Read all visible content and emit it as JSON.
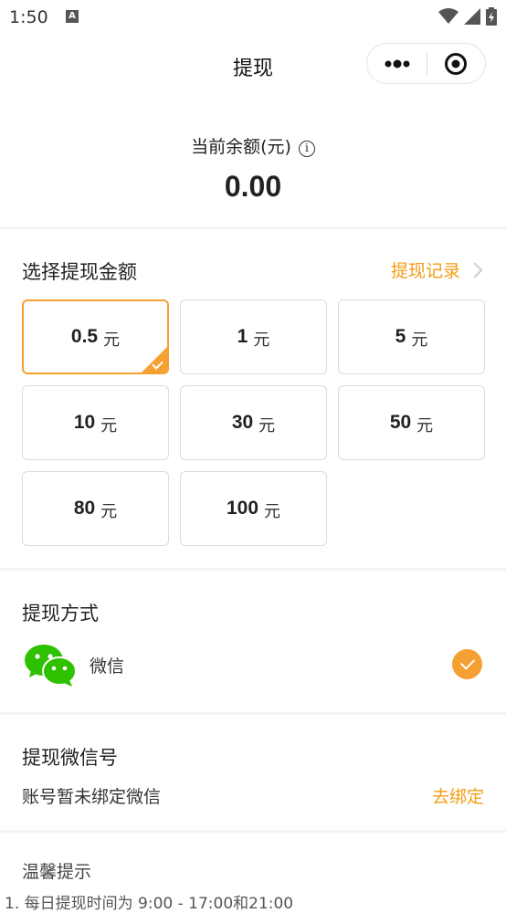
{
  "status_bar": {
    "time": "1:50",
    "notification_icon": "A"
  },
  "navbar": {
    "title": "提现",
    "menu_icon": "more-dots-icon",
    "close_icon": "target-close-icon"
  },
  "balance": {
    "label": "当前余额(元)",
    "info_icon": "i",
    "value": "0.00"
  },
  "amount_section": {
    "title": "选择提现金额",
    "record_link": "提现记录",
    "unit": "元",
    "options": [
      "0.5",
      "1",
      "5",
      "10",
      "30",
      "50",
      "80",
      "100"
    ],
    "selected": "0.5"
  },
  "method_section": {
    "title": "提现方式",
    "option_label": "微信",
    "selected": true
  },
  "wechat_section": {
    "title": "提现微信号",
    "status": "账号暂未绑定微信",
    "action": "去绑定"
  },
  "tips": {
    "title": "温馨提示",
    "line1": "1. 每日提现时间为 9:00 - 17:00和21:00"
  },
  "colors": {
    "accent": "#f5a032",
    "wechat_green": "#2dc100"
  }
}
